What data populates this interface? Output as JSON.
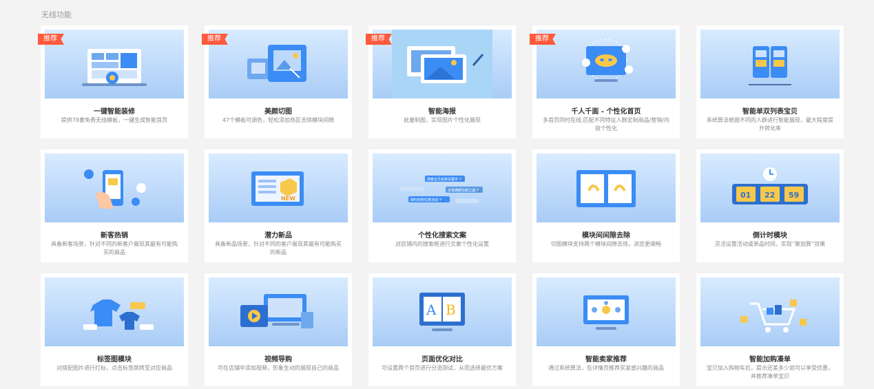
{
  "section": {
    "title": "无线功能"
  },
  "colors": {
    "badge": "#ff5a3c",
    "accent": "#3b8cf5",
    "thumb_bg": "#b9d6f8"
  },
  "cards": [
    {
      "title": "一键智能装修",
      "desc": "提供78套免费无线模板，一键生成智能首页",
      "badge": "推荐",
      "icon": "layout-desktop-icon"
    },
    {
      "title": "美颜切图",
      "desc": "47个模板可调色，轻松添加热区去除模块间隙",
      "badge": "推荐",
      "icon": "image-crop-icon"
    },
    {
      "title": "智能海报",
      "desc": "批量制图，实现图片个性化展现",
      "badge": "推荐",
      "icon": "poster-icon"
    },
    {
      "title": "千人千面 - 个性化首页",
      "desc": "多首页同时在线,匹配不同特征人群定制商品/营销/内容个性化",
      "badge": "推荐",
      "icon": "mask-personalize-icon"
    },
    {
      "title": "智能单双列表宝贝",
      "desc": "系统算法根据不同的人群进行智能展现，最大程度提升转化率",
      "badge": "",
      "icon": "dual-list-icon"
    },
    {
      "title": "新客热销",
      "desc": "具备新客场景，针对不同的新客户展现其最有可能购买的商品",
      "badge": "",
      "icon": "phone-hand-icon"
    },
    {
      "title": "潜力新品",
      "desc": "具备新品场景，针对不同的客户展现其最有可能购买的新品",
      "badge": "",
      "icon": "new-product-icon"
    },
    {
      "title": "个性化搜索文案",
      "desc": "对店铺内的搜索框进行文案个性化设置",
      "badge": "",
      "icon": "search-text-icon"
    },
    {
      "title": "模块间间隙去除",
      "desc": "切图模块支持两个模块间隙去除，浏览更顺畅",
      "badge": "",
      "icon": "gap-remove-icon"
    },
    {
      "title": "倒计时模块",
      "desc": "灵活设置活动或单品时间，实现“聚划算”效果",
      "badge": "",
      "icon": "countdown-icon"
    },
    {
      "title": "标签图模块",
      "desc": "对搭配图片进行打标，点击标签跳转至对应商品",
      "badge": "",
      "icon": "tag-clothes-icon"
    },
    {
      "title": "视频导购",
      "desc": "可在店铺中添加视频，形象生动的展现自己的商品",
      "badge": "",
      "icon": "video-play-icon"
    },
    {
      "title": "页面优化对比",
      "desc": "可设置两个首页进行分流测试，从而选择最优方案",
      "badge": "",
      "icon": "ab-test-icon"
    },
    {
      "title": "智能卖家推荐",
      "desc": "通过系统算法，在详情页推荐买家感兴趣的商品",
      "badge": "",
      "icon": "recommend-icon"
    },
    {
      "title": "智能加购凑单",
      "desc": "宝贝加入购物车后，提示还差多少就可以享受优惠，并推荐凑单宝贝",
      "badge": "",
      "icon": "cart-icon"
    }
  ],
  "countdown_digits": [
    "01",
    "22",
    "59"
  ],
  "ab_letters": [
    "A",
    "B"
  ],
  "new_label": "NEW",
  "search_chips": [
    "搜索宝贝名称关键字 🔍",
    "全场满额包邮立减 🔍",
    "限时抢购优惠活动 🔍"
  ]
}
